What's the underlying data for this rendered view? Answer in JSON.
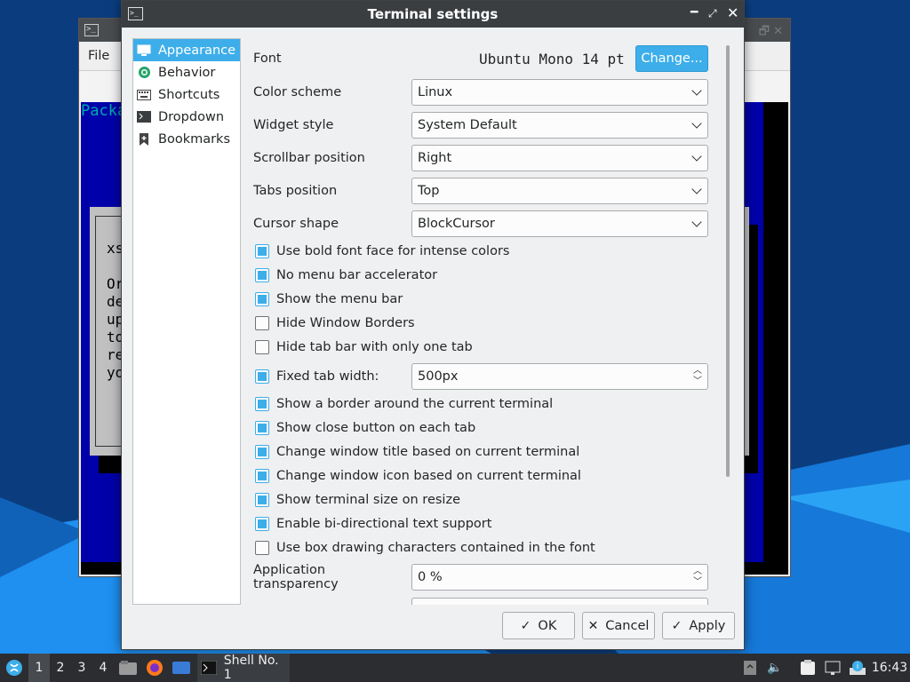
{
  "background_window": {
    "menu_file": "File",
    "terminal_header": "Packa",
    "dialog_lines": [
      "xs",
      "",
      "Or",
      "de",
      "up",
      "to",
      "re",
      "yo"
    ]
  },
  "dialog": {
    "title": "Terminal settings",
    "sidebar": [
      {
        "label": "Appearance",
        "icon": "appearance-icon"
      },
      {
        "label": "Behavior",
        "icon": "behavior-icon"
      },
      {
        "label": "Shortcuts",
        "icon": "keyboard-icon"
      },
      {
        "label": "Dropdown",
        "icon": "terminal-icon"
      },
      {
        "label": "Bookmarks",
        "icon": "bookmark-icon"
      }
    ],
    "font": {
      "label": "Font",
      "value": "Ubuntu Mono 14 pt",
      "button": "Change..."
    },
    "selects": [
      {
        "label": "Color scheme",
        "value": "Linux"
      },
      {
        "label": "Widget style",
        "value": "System Default"
      },
      {
        "label": "Scrollbar position",
        "value": "Right"
      },
      {
        "label": "Tabs position",
        "value": "Top"
      },
      {
        "label": "Cursor shape",
        "value": "BlockCursor"
      }
    ],
    "checks_a": [
      {
        "label": "Use bold font face for intense colors",
        "checked": true
      },
      {
        "label": "No menu bar accelerator",
        "checked": true
      },
      {
        "label": "Show the menu bar",
        "checked": true
      },
      {
        "label": "Hide Window Borders",
        "checked": false
      },
      {
        "label": "Hide tab bar with only one tab",
        "checked": false
      }
    ],
    "fixed_tab": {
      "label": "Fixed tab width:",
      "checked": true,
      "value": "500px"
    },
    "checks_b": [
      {
        "label": "Show a border around the current terminal",
        "checked": true
      },
      {
        "label": "Show close button on each tab",
        "checked": true
      },
      {
        "label": "Change window title based on current terminal",
        "checked": true
      },
      {
        "label": "Change window icon based on current terminal",
        "checked": true
      },
      {
        "label": "Show terminal size on resize",
        "checked": true
      },
      {
        "label": "Enable bi-directional text support",
        "checked": true
      },
      {
        "label": "Use box drawing characters contained in the font",
        "checked": false
      }
    ],
    "transparency": {
      "label": "Application transparency",
      "value": "0 %"
    },
    "buttons": {
      "ok": "OK",
      "cancel": "Cancel",
      "apply": "Apply"
    }
  },
  "taskbar": {
    "workspaces": [
      "1",
      "2",
      "3",
      "4"
    ],
    "task_label": "Shell No. 1",
    "clock": "16:43"
  },
  "colors": {
    "accent": "#3daee9",
    "titlebar": "#3b3e41",
    "taskbar": "#2b2d31"
  }
}
